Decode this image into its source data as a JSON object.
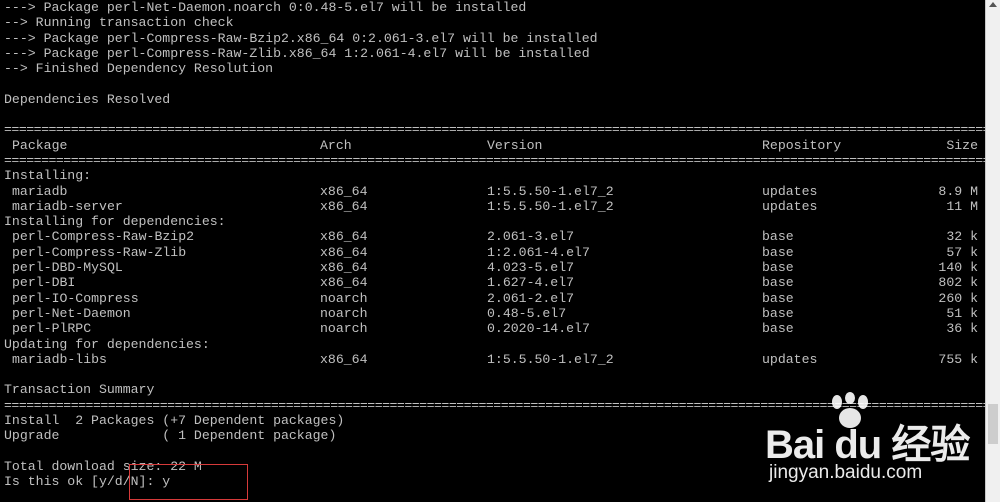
{
  "terminal": {
    "lines_top": [
      "---> Package perl-Net-Daemon.noarch 0:0.48-5.el7 will be installed",
      "--> Running transaction check",
      "---> Package perl-Compress-Raw-Bzip2.x86_64 0:2.061-3.el7 will be installed",
      "---> Package perl-Compress-Raw-Zlib.x86_64 1:2.061-4.el7 will be installed",
      "--> Finished Dependency Resolution",
      "",
      "Dependencies Resolved",
      ""
    ],
    "table": {
      "headers": {
        "package": "Package",
        "arch": "Arch",
        "version": "Version",
        "repository": "Repository",
        "size": "Size"
      },
      "sections": [
        {
          "title": "Installing:",
          "rows": [
            {
              "package": "mariadb",
              "arch": "x86_64",
              "version": "1:5.5.50-1.el7_2",
              "repository": "updates",
              "size": "8.9 M"
            },
            {
              "package": "mariadb-server",
              "arch": "x86_64",
              "version": "1:5.5.50-1.el7_2",
              "repository": "updates",
              "size": "11 M"
            }
          ]
        },
        {
          "title": "Installing for dependencies:",
          "rows": [
            {
              "package": "perl-Compress-Raw-Bzip2",
              "arch": "x86_64",
              "version": "2.061-3.el7",
              "repository": "base",
              "size": "32 k"
            },
            {
              "package": "perl-Compress-Raw-Zlib",
              "arch": "x86_64",
              "version": "1:2.061-4.el7",
              "repository": "base",
              "size": "57 k"
            },
            {
              "package": "perl-DBD-MySQL",
              "arch": "x86_64",
              "version": "4.023-5.el7",
              "repository": "base",
              "size": "140 k"
            },
            {
              "package": "perl-DBI",
              "arch": "x86_64",
              "version": "1.627-4.el7",
              "repository": "base",
              "size": "802 k"
            },
            {
              "package": "perl-IO-Compress",
              "arch": "noarch",
              "version": "2.061-2.el7",
              "repository": "base",
              "size": "260 k"
            },
            {
              "package": "perl-Net-Daemon",
              "arch": "noarch",
              "version": "0.48-5.el7",
              "repository": "base",
              "size": "51 k"
            },
            {
              "package": "perl-PlRPC",
              "arch": "noarch",
              "version": "0.2020-14.el7",
              "repository": "base",
              "size": "36 k"
            }
          ]
        },
        {
          "title": "Updating for dependencies:",
          "rows": [
            {
              "package": "mariadb-libs",
              "arch": "x86_64",
              "version": "1:5.5.50-1.el7_2",
              "repository": "updates",
              "size": "755 k"
            }
          ]
        }
      ]
    },
    "summary": {
      "title": "Transaction Summary",
      "install_line": "Install  2 Packages (+7 Dependent packages)",
      "upgrade_line": "Upgrade             ( 1 Dependent package)",
      "download_line": "Total download size: 22 M",
      "prompt_text": "Is this ok [y/d/N]: ",
      "prompt_input": "y"
    }
  },
  "watermark": {
    "logo": "Bai du 经验",
    "url": "jingyan.baidu.com"
  },
  "colors": {
    "background": "#000000",
    "text": "#c0c0c0",
    "highlight": "#d63a3a"
  }
}
